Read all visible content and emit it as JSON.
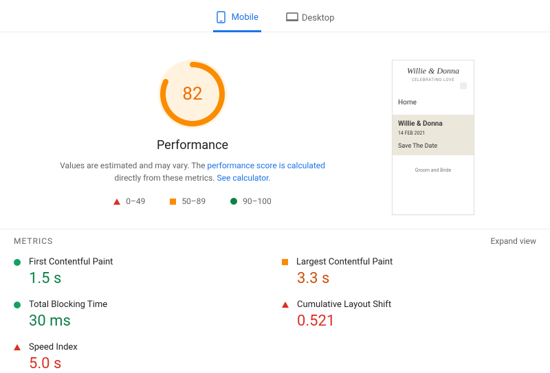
{
  "tabs": {
    "mobile": "Mobile",
    "desktop": "Desktop"
  },
  "score": {
    "value": "82",
    "title": "Performance"
  },
  "description": {
    "pre": "Values are estimated and may vary. The ",
    "link1": "performance score is calculated",
    "mid": " directly from these metrics. ",
    "link2": "See calculator."
  },
  "legend": {
    "poor": "0–49",
    "avg": "50–89",
    "good": "90–100"
  },
  "preview": {
    "brand": "Willie & Donna",
    "tagline": "CELEBRATING LOVE",
    "nav": "Home",
    "card_title": "Willie & Donna",
    "card_date": "14 FEB 2021",
    "card_sub": "Save The Date",
    "footer": "Groom and Bride"
  },
  "metrics_title": "METRICS",
  "expand": "Expand view",
  "metrics": {
    "fcp": {
      "label": "First Contentful Paint",
      "value": "1.5 s"
    },
    "lcp": {
      "label": "Largest Contentful Paint",
      "value": "3.3 s"
    },
    "tbt": {
      "label": "Total Blocking Time",
      "value": "30 ms"
    },
    "cls": {
      "label": "Cumulative Layout Shift",
      "value": "0.521"
    },
    "si": {
      "label": "Speed Index",
      "value": "5.0 s"
    }
  }
}
